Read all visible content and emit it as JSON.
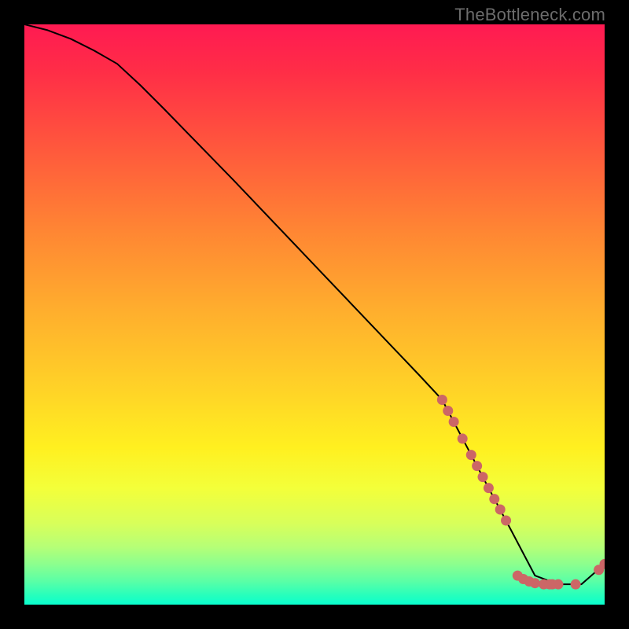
{
  "watermark": "TheBottleneck.com",
  "chart_data": {
    "type": "line",
    "title": "",
    "xlabel": "",
    "ylabel": "",
    "xlim": [
      0,
      100
    ],
    "ylim": [
      0,
      100
    ],
    "grid": false,
    "legend": false,
    "series": [
      {
        "name": "curve",
        "style": "solid-black",
        "x": [
          0,
          4,
          8,
          12,
          16,
          20,
          24,
          28,
          32,
          36,
          40,
          44,
          48,
          52,
          56,
          60,
          64,
          68,
          72,
          76,
          80,
          84,
          88,
          92,
          96,
          100
        ],
        "y": [
          100,
          99,
          97.5,
          95.5,
          93.2,
          89.5,
          85.5,
          81.4,
          77.3,
          73.2,
          69.0,
          64.8,
          60.6,
          56.4,
          52.2,
          48.0,
          43.8,
          39.6,
          35.3,
          27.7,
          20.1,
          12.6,
          5.0,
          3.5,
          3.5,
          7.0
        ]
      },
      {
        "name": "markers",
        "style": "dots-salmon",
        "points": [
          {
            "x": 72.0,
            "y": 35.3
          },
          {
            "x": 73.0,
            "y": 33.4
          },
          {
            "x": 74.0,
            "y": 31.5
          },
          {
            "x": 75.5,
            "y": 28.6
          },
          {
            "x": 77.0,
            "y": 25.8
          },
          {
            "x": 78.0,
            "y": 23.9
          },
          {
            "x": 79.0,
            "y": 22.0
          },
          {
            "x": 80.0,
            "y": 20.1
          },
          {
            "x": 81.0,
            "y": 18.2
          },
          {
            "x": 82.0,
            "y": 16.4
          },
          {
            "x": 83.0,
            "y": 14.5
          },
          {
            "x": 85.0,
            "y": 5.0
          },
          {
            "x": 86.0,
            "y": 4.4
          },
          {
            "x": 87.0,
            "y": 4.0
          },
          {
            "x": 88.0,
            "y": 3.7
          },
          {
            "x": 89.5,
            "y": 3.5
          },
          {
            "x": 90.5,
            "y": 3.5
          },
          {
            "x": 91.0,
            "y": 3.5
          },
          {
            "x": 92.0,
            "y": 3.5
          },
          {
            "x": 95.0,
            "y": 3.5
          },
          {
            "x": 99.0,
            "y": 6.0
          },
          {
            "x": 100.0,
            "y": 7.0
          }
        ]
      }
    ],
    "colors": {
      "curve": "#000000",
      "markers": "#cc6666"
    }
  }
}
